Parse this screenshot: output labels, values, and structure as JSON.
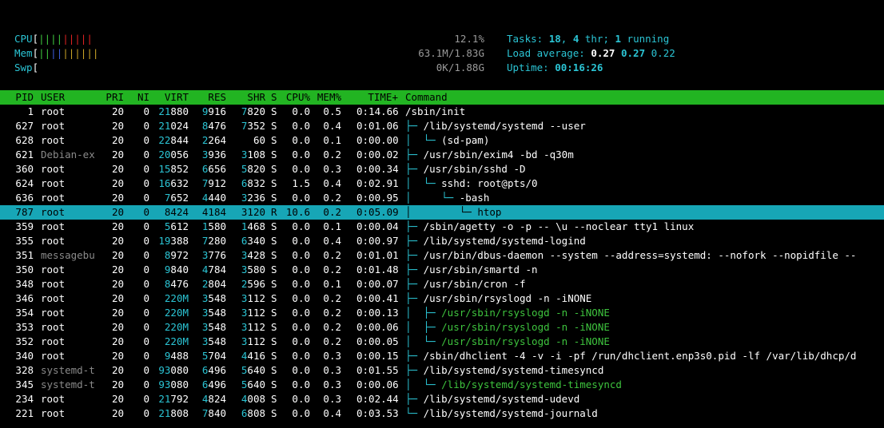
{
  "meters": {
    "cpu": {
      "label": "CPU",
      "value": "12.1%"
    },
    "mem": {
      "label": "Mem",
      "value": "63.1M/1.83G"
    },
    "swp": {
      "label": "Swp",
      "value": "0K/1.88G"
    }
  },
  "stats": {
    "tasks_label": "Tasks: ",
    "tasks": "18",
    "thr": "4",
    "thr_label": " thr; ",
    "running": "1",
    "running_label": " running",
    "load_label": "Load average: ",
    "load1": "0.27",
    "load5": "0.27",
    "load15": "0.22",
    "uptime_label": "Uptime: ",
    "uptime": "00:16:26"
  },
  "colors": {
    "header_bg": "#22b422",
    "selected_bg": "#17a6b6",
    "cyan": "#2bc4d4",
    "green": "#3ec43e"
  },
  "columns": [
    "PID",
    "USER",
    "PRI",
    "NI",
    "VIRT",
    "RES",
    "SHR",
    "S",
    "CPU%",
    "MEM%",
    "TIME+",
    "Command"
  ],
  "processes": [
    {
      "pid": "1",
      "user": "root",
      "pri": "20",
      "ni": "0",
      "virt": "21880",
      "res": "9916",
      "shr": "7820",
      "s": "S",
      "cpu": "0.0",
      "mem": "0.5",
      "time": "0:14.66",
      "tree": "",
      "cmd": "/sbin/init",
      "thread": false,
      "selected": false,
      "dimuser": false
    },
    {
      "pid": "627",
      "user": "root",
      "pri": "20",
      "ni": "0",
      "virt": "21024",
      "res": "8476",
      "shr": "7352",
      "s": "S",
      "cpu": "0.0",
      "mem": "0.4",
      "time": "0:01.06",
      "tree": "├─ ",
      "cmd": "/lib/systemd/systemd --user",
      "thread": false,
      "selected": false,
      "dimuser": false
    },
    {
      "pid": "628",
      "user": "root",
      "pri": "20",
      "ni": "0",
      "virt": "22844",
      "res": "2264",
      "shr": "60",
      "s": "S",
      "cpu": "0.0",
      "mem": "0.1",
      "time": "0:00.00",
      "tree": "│  └─ ",
      "cmd": "(sd-pam)",
      "thread": false,
      "selected": false,
      "dimuser": false
    },
    {
      "pid": "621",
      "user": "Debian-ex",
      "pri": "20",
      "ni": "0",
      "virt": "20056",
      "res": "3936",
      "shr": "3108",
      "s": "S",
      "cpu": "0.0",
      "mem": "0.2",
      "time": "0:00.02",
      "tree": "├─ ",
      "cmd": "/usr/sbin/exim4 -bd -q30m",
      "thread": false,
      "selected": false,
      "dimuser": true
    },
    {
      "pid": "360",
      "user": "root",
      "pri": "20",
      "ni": "0",
      "virt": "15852",
      "res": "6656",
      "shr": "5820",
      "s": "S",
      "cpu": "0.0",
      "mem": "0.3",
      "time": "0:00.34",
      "tree": "├─ ",
      "cmd": "/usr/sbin/sshd -D",
      "thread": false,
      "selected": false,
      "dimuser": false
    },
    {
      "pid": "624",
      "user": "root",
      "pri": "20",
      "ni": "0",
      "virt": "16632",
      "res": "7912",
      "shr": "6832",
      "s": "S",
      "cpu": "1.5",
      "mem": "0.4",
      "time": "0:02.91",
      "tree": "│  └─ ",
      "cmd": "sshd: root@pts/0",
      "thread": false,
      "selected": false,
      "dimuser": false
    },
    {
      "pid": "636",
      "user": "root",
      "pri": "20",
      "ni": "0",
      "virt": "7652",
      "res": "4440",
      "shr": "3236",
      "s": "S",
      "cpu": "0.0",
      "mem": "0.2",
      "time": "0:00.95",
      "tree": "│     └─ ",
      "cmd": "-bash",
      "thread": false,
      "selected": false,
      "dimuser": false
    },
    {
      "pid": "787",
      "user": "root",
      "pri": "20",
      "ni": "0",
      "virt": "8424",
      "res": "4184",
      "shr": "3120",
      "s": "R",
      "cpu": "10.6",
      "mem": "0.2",
      "time": "0:05.09",
      "tree": "│        └─ ",
      "cmd": "htop",
      "thread": false,
      "selected": true,
      "dimuser": false
    },
    {
      "pid": "359",
      "user": "root",
      "pri": "20",
      "ni": "0",
      "virt": "5612",
      "res": "1580",
      "shr": "1468",
      "s": "S",
      "cpu": "0.0",
      "mem": "0.1",
      "time": "0:00.04",
      "tree": "├─ ",
      "cmd": "/sbin/agetty -o -p -- \\u --noclear tty1 linux",
      "thread": false,
      "selected": false,
      "dimuser": false
    },
    {
      "pid": "355",
      "user": "root",
      "pri": "20",
      "ni": "0",
      "virt": "19388",
      "res": "7280",
      "shr": "6340",
      "s": "S",
      "cpu": "0.0",
      "mem": "0.4",
      "time": "0:00.97",
      "tree": "├─ ",
      "cmd": "/lib/systemd/systemd-logind",
      "thread": false,
      "selected": false,
      "dimuser": false
    },
    {
      "pid": "351",
      "user": "messagebu",
      "pri": "20",
      "ni": "0",
      "virt": "8972",
      "res": "3776",
      "shr": "3428",
      "s": "S",
      "cpu": "0.0",
      "mem": "0.2",
      "time": "0:01.01",
      "tree": "├─ ",
      "cmd": "/usr/bin/dbus-daemon --system --address=systemd: --nofork --nopidfile --",
      "thread": false,
      "selected": false,
      "dimuser": true
    },
    {
      "pid": "350",
      "user": "root",
      "pri": "20",
      "ni": "0",
      "virt": "9840",
      "res": "4784",
      "shr": "3580",
      "s": "S",
      "cpu": "0.0",
      "mem": "0.2",
      "time": "0:01.48",
      "tree": "├─ ",
      "cmd": "/usr/sbin/smartd -n",
      "thread": false,
      "selected": false,
      "dimuser": false
    },
    {
      "pid": "348",
      "user": "root",
      "pri": "20",
      "ni": "0",
      "virt": "8476",
      "res": "2804",
      "shr": "2596",
      "s": "S",
      "cpu": "0.0",
      "mem": "0.1",
      "time": "0:00.07",
      "tree": "├─ ",
      "cmd": "/usr/sbin/cron -f",
      "thread": false,
      "selected": false,
      "dimuser": false
    },
    {
      "pid": "346",
      "user": "root",
      "pri": "20",
      "ni": "0",
      "virt": "220M",
      "res": "3548",
      "shr": "3112",
      "s": "S",
      "cpu": "0.0",
      "mem": "0.2",
      "time": "0:00.41",
      "tree": "├─ ",
      "cmd": "/usr/sbin/rsyslogd -n -iNONE",
      "thread": false,
      "selected": false,
      "dimuser": false
    },
    {
      "pid": "354",
      "user": "root",
      "pri": "20",
      "ni": "0",
      "virt": "220M",
      "res": "3548",
      "shr": "3112",
      "s": "S",
      "cpu": "0.0",
      "mem": "0.2",
      "time": "0:00.13",
      "tree": "│  ├─ ",
      "cmd": "/usr/sbin/rsyslogd -n -iNONE",
      "thread": true,
      "selected": false,
      "dimuser": false
    },
    {
      "pid": "353",
      "user": "root",
      "pri": "20",
      "ni": "0",
      "virt": "220M",
      "res": "3548",
      "shr": "3112",
      "s": "S",
      "cpu": "0.0",
      "mem": "0.2",
      "time": "0:00.06",
      "tree": "│  ├─ ",
      "cmd": "/usr/sbin/rsyslogd -n -iNONE",
      "thread": true,
      "selected": false,
      "dimuser": false
    },
    {
      "pid": "352",
      "user": "root",
      "pri": "20",
      "ni": "0",
      "virt": "220M",
      "res": "3548",
      "shr": "3112",
      "s": "S",
      "cpu": "0.0",
      "mem": "0.2",
      "time": "0:00.05",
      "tree": "│  └─ ",
      "cmd": "/usr/sbin/rsyslogd -n -iNONE",
      "thread": true,
      "selected": false,
      "dimuser": false
    },
    {
      "pid": "340",
      "user": "root",
      "pri": "20",
      "ni": "0",
      "virt": "9488",
      "res": "5704",
      "shr": "4416",
      "s": "S",
      "cpu": "0.0",
      "mem": "0.3",
      "time": "0:00.15",
      "tree": "├─ ",
      "cmd": "/sbin/dhclient -4 -v -i -pf /run/dhclient.enp3s0.pid -lf /var/lib/dhcp/d",
      "thread": false,
      "selected": false,
      "dimuser": false
    },
    {
      "pid": "328",
      "user": "systemd-t",
      "pri": "20",
      "ni": "0",
      "virt": "93080",
      "res": "6496",
      "shr": "5640",
      "s": "S",
      "cpu": "0.0",
      "mem": "0.3",
      "time": "0:01.55",
      "tree": "├─ ",
      "cmd": "/lib/systemd/systemd-timesyncd",
      "thread": false,
      "selected": false,
      "dimuser": true
    },
    {
      "pid": "345",
      "user": "systemd-t",
      "pri": "20",
      "ni": "0",
      "virt": "93080",
      "res": "6496",
      "shr": "5640",
      "s": "S",
      "cpu": "0.0",
      "mem": "0.3",
      "time": "0:00.06",
      "tree": "│  └─ ",
      "cmd": "/lib/systemd/systemd-timesyncd",
      "thread": true,
      "selected": false,
      "dimuser": true
    },
    {
      "pid": "234",
      "user": "root",
      "pri": "20",
      "ni": "0",
      "virt": "21792",
      "res": "4824",
      "shr": "4008",
      "s": "S",
      "cpu": "0.0",
      "mem": "0.3",
      "time": "0:02.44",
      "tree": "├─ ",
      "cmd": "/lib/systemd/systemd-udevd",
      "thread": false,
      "selected": false,
      "dimuser": false
    },
    {
      "pid": "221",
      "user": "root",
      "pri": "20",
      "ni": "0",
      "virt": "21808",
      "res": "7840",
      "shr": "6808",
      "s": "S",
      "cpu": "0.0",
      "mem": "0.4",
      "time": "0:03.53",
      "tree": "└─ ",
      "cmd": "/lib/systemd/systemd-journald",
      "thread": false,
      "selected": false,
      "dimuser": false
    }
  ]
}
